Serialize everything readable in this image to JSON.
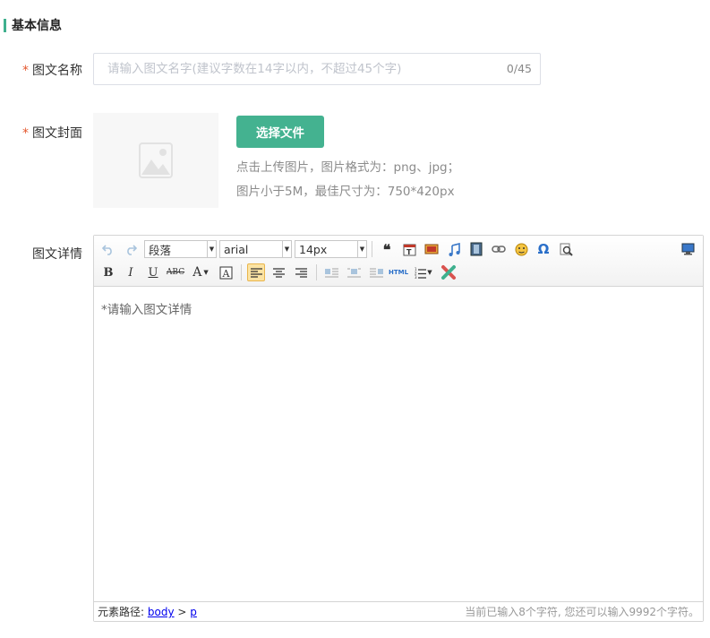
{
  "section": {
    "title": "基本信息"
  },
  "form": {
    "name": {
      "required_mark": "*",
      "label": "图文名称",
      "placeholder": "请输入图文名字(建议字数在14字以内，不超过45个字)",
      "value": "",
      "counter": "0/45"
    },
    "cover": {
      "required_mark": "*",
      "label": "图文封面",
      "upload_label": "选择文件",
      "hint_line1": "点击上传图片，图片格式为：png、jpg；",
      "hint_line2": "图片小于5M，最佳尺寸为：750*420px"
    },
    "detail": {
      "label": "图文详情"
    }
  },
  "editor": {
    "paragraph_select": "段落",
    "font_select": "arial",
    "size_select": "14px",
    "content_placeholder": "*请输入图文详情",
    "status_path_label": "元素路径:",
    "status_path_body": "body",
    "status_path_sep": ">",
    "status_path_p": "p",
    "status_count": "当前已输入8个字符, 您还可以输入9992个字符。"
  },
  "colors": {
    "accent": "#44b290",
    "required": "#e4572e",
    "placeholder": "#c0c4cc"
  },
  "icons": [
    "undo-icon",
    "redo-icon",
    "blockquote-icon",
    "insert-frame-icon",
    "insert-image-icon",
    "music-icon",
    "video-icon",
    "link-icon",
    "emotion-icon",
    "special-char-icon",
    "search-replace-icon",
    "preview-icon",
    "bold-icon",
    "italic-icon",
    "underline-icon",
    "strikethrough-icon",
    "font-color-icon",
    "background-color-icon",
    "align-left-icon",
    "align-center-icon",
    "align-right-icon",
    "image-left-icon",
    "image-center-icon",
    "image-right-icon",
    "html-source-icon",
    "ordered-list-icon",
    "clear-format-icon",
    "image-placeholder-icon"
  ]
}
